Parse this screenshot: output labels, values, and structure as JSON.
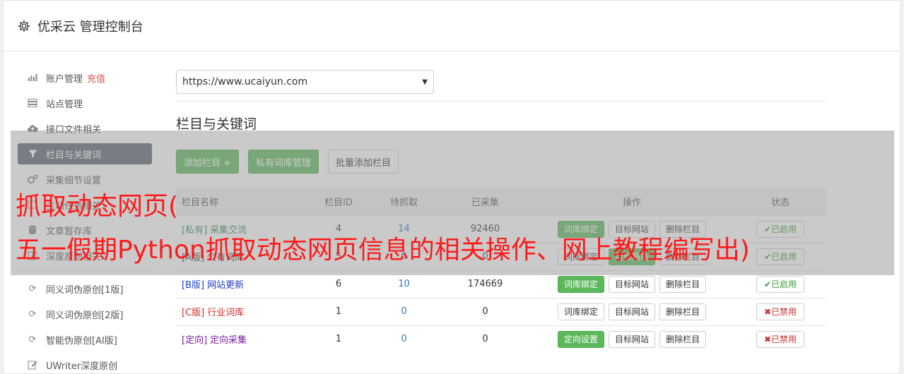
{
  "header": {
    "title": "优采云 管理控制台"
  },
  "sidebar": {
    "items": [
      {
        "label": "账户管理",
        "extra": "充值",
        "icon": "bar-chart-icon"
      },
      {
        "label": "站点管理",
        "icon": "server-icon"
      },
      {
        "label": "接口文件相关",
        "icon": "cloud-upload-icon"
      },
      {
        "label": "栏目与关键词",
        "icon": "filter-icon",
        "active": true
      },
      {
        "label": "采集细节设置",
        "icon": "gears-icon"
      },
      {
        "label": "主动任务相关",
        "icon": "task-icon"
      },
      {
        "label": "文章暂存库",
        "icon": "database-icon"
      },
      {
        "label": "深度原创相关",
        "icon": "edit-icon"
      }
    ],
    "tools": [
      {
        "label": "同义词伪原创[1版]",
        "icon": "refresh-icon"
      },
      {
        "label": "同义词伪原创[2版]",
        "icon": "refresh-icon"
      },
      {
        "label": "智能伪原创[AI版]",
        "icon": "refresh-icon"
      },
      {
        "label": "UWriter深度原创",
        "icon": "edit-icon"
      }
    ]
  },
  "main": {
    "site_select": "https://www.ucaiyun.com",
    "section_title": "栏目与关键词",
    "buttons": {
      "add": "添加栏目 +",
      "private": "私有词库管理",
      "batch": "批量添加栏目"
    },
    "columns": [
      "栏目名称",
      "栏目ID",
      "待抓取",
      "已采集",
      "操作",
      "状态"
    ],
    "rows": [
      {
        "tag": "[私有]",
        "name": "采集交流",
        "id": "4",
        "pending": "14",
        "collected": "92460",
        "op1": "词库绑定",
        "op2": "目标网站",
        "op3": "删除栏目",
        "status": "✔已启用"
      },
      {
        "tag": "[A版]",
        "name": "公有词库",
        "id": "5",
        "pending": "0",
        "collected": "0",
        "op1": "词库绑定",
        "op2": "目标网站",
        "op3": "删除栏目",
        "status": "✔已启用"
      },
      {
        "tag": "[B版]",
        "name": "网站更新",
        "id": "6",
        "pending": "10",
        "collected": "174669",
        "op1": "词库绑定",
        "op2": "目标网站",
        "op3": "删除栏目",
        "status": "✔已启用"
      },
      {
        "tag": "[C版]",
        "name": "行业词库",
        "id": "1",
        "pending": "0",
        "collected": "0",
        "op1": "词库绑定",
        "op2": "目标网站",
        "op3": "删除栏目",
        "status": "✖已禁用"
      },
      {
        "tag": "[定向]",
        "name": "定向采集",
        "id": "1",
        "pending": "0",
        "collected": "0",
        "op1": "定向设置",
        "op2": "目标网站",
        "op3": "删除栏目",
        "status": "✖已禁用"
      }
    ]
  },
  "overlay": {
    "line1": "抓取动态网页(",
    "line2": "五一假期Python抓取动态网页信息的相关操作、网上教程编写出)"
  },
  "colors": {
    "accent_green": "#5cb85c",
    "active_nav": "#5a6473",
    "overlay_text": "#ff1a1a"
  }
}
